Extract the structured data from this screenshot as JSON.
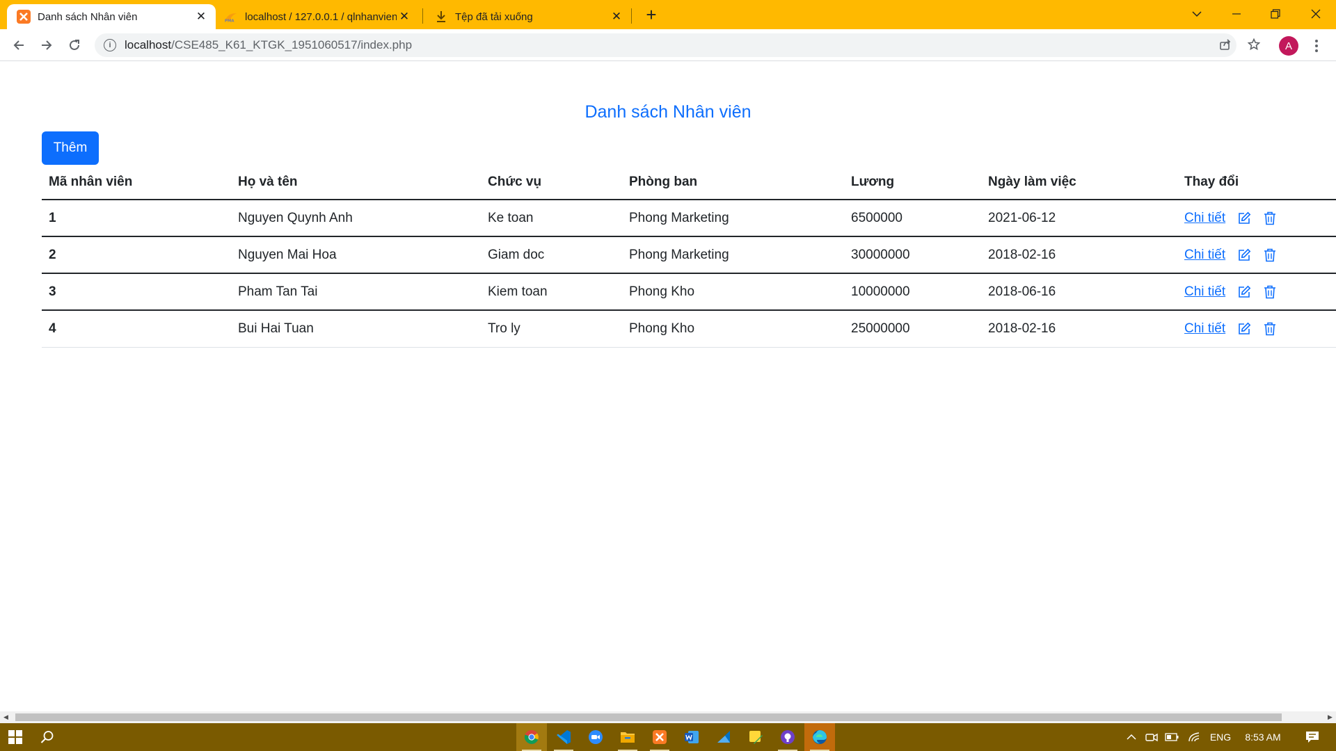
{
  "browser": {
    "tabs": [
      {
        "label": "Danh sách Nhân viên",
        "active": true,
        "favicon": "xampp-icon"
      },
      {
        "label": "localhost / 127.0.0.1 / qlnhanvien",
        "active": false,
        "favicon": "phpmyadmin-icon"
      },
      {
        "label": "Tệp đã tải xuống",
        "active": false,
        "favicon": "download-icon"
      }
    ],
    "tab_close_glyph": "✕",
    "new_tab_glyph": "+",
    "url": {
      "host": "localhost",
      "path": "/CSE485_K61_KTGK_1951060517/index.php"
    },
    "profile_initial": "A",
    "accent_color": "#ffb900"
  },
  "page": {
    "title": "Danh sách Nhân viên",
    "add_button_label": "Thêm",
    "table": {
      "headers": [
        "Mã nhân viên",
        "Họ và tên",
        "Chức vụ",
        "Phòng ban",
        "Lương",
        "Ngày làm việc",
        "Thay đổi"
      ],
      "rows": [
        {
          "id": "1",
          "name": "Nguyen Quynh Anh",
          "position": "Ke toan",
          "department": "Phong Marketing",
          "salary": "6500000",
          "start_date": "2021-06-12",
          "detail_label": "Chi tiết"
        },
        {
          "id": "2",
          "name": "Nguyen Mai Hoa",
          "position": "Giam doc",
          "department": "Phong Marketing",
          "salary": "30000000",
          "start_date": "2018-02-16",
          "detail_label": "Chi tiết"
        },
        {
          "id": "3",
          "name": "Pham Tan Tai",
          "position": "Kiem toan",
          "department": "Phong Kho",
          "salary": "10000000",
          "start_date": "2018-06-16",
          "detail_label": "Chi tiết"
        },
        {
          "id": "4",
          "name": "Bui Hai Tuan",
          "position": "Tro ly",
          "department": "Phong Kho",
          "salary": "25000000",
          "start_date": "2018-02-16",
          "detail_label": "Chi tiết"
        }
      ]
    },
    "primary_color": "#0d6efd"
  },
  "taskbar": {
    "apps": [
      "chrome-icon",
      "vscode-icon",
      "zoom-icon",
      "file-explorer-icon",
      "xampp-icon",
      "word-icon",
      "azure-data-studio-icon",
      "sticky-notes-icon",
      "github-desktop-icon",
      "edge-icon"
    ],
    "language": "ENG",
    "time": "8:53 AM",
    "color": "#7a5a00"
  }
}
